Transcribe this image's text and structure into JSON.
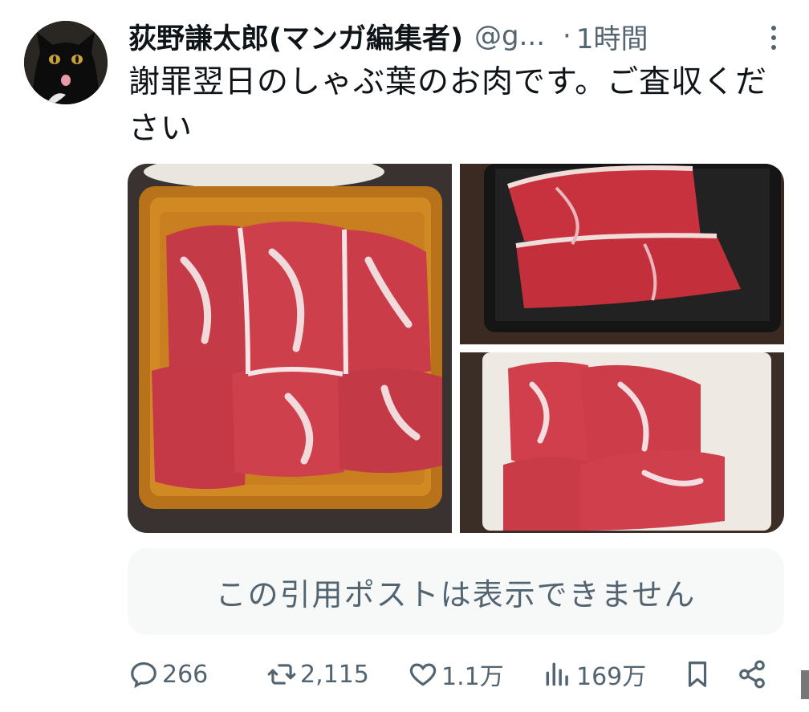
{
  "author": {
    "display_name": "荻野謙太郎(マンガ編集者)",
    "handle": "@g...",
    "separator": "·",
    "time": "1時間"
  },
  "tweet": {
    "text": "謝罪翌日のしゃぶ葉のお肉です。ご査収ください"
  },
  "media": {
    "count": 3
  },
  "quote": {
    "unavailable_text": "この引用ポストは表示できません"
  },
  "actions": {
    "reply_count": "266",
    "retweet_count": "2,115",
    "like_count": "1.1万",
    "view_count": "169万"
  },
  "colors": {
    "text_primary": "#0f1419",
    "text_secondary": "#536471",
    "quote_bg": "#f7f9f9"
  }
}
